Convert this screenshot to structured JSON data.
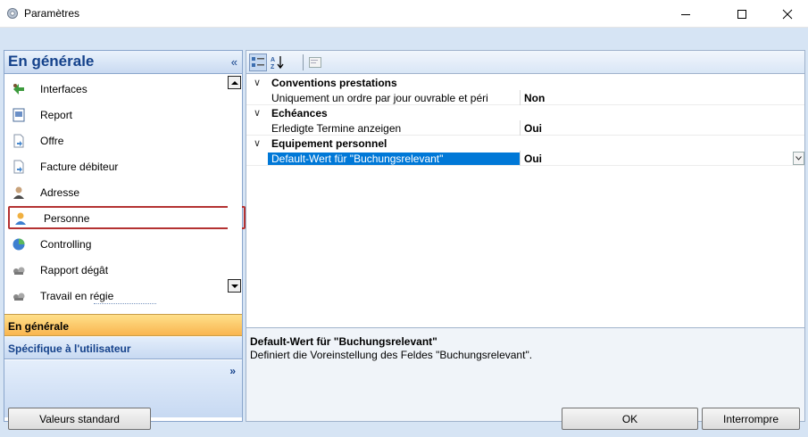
{
  "window": {
    "title": "Paramètres",
    "minimize_glyph": "—",
    "maximize_glyph": "☐",
    "close_glyph": "✕"
  },
  "nav": {
    "header_title": "En générale",
    "collapse_glyph": "«",
    "items": [
      {
        "label": "Interfaces",
        "icon": "interfaces-icon"
      },
      {
        "label": "Report",
        "icon": "report-icon"
      },
      {
        "label": "Offre",
        "icon": "offer-icon"
      },
      {
        "label": "Facture débiteur",
        "icon": "invoice-icon"
      },
      {
        "label": "Adresse",
        "icon": "address-icon"
      },
      {
        "label": "Personne",
        "icon": "person-icon",
        "selected": true
      },
      {
        "label": "Controlling",
        "icon": "controlling-icon"
      },
      {
        "label": "Rapport dégât",
        "icon": "damage-report-icon"
      },
      {
        "label": "Travail en régie",
        "icon": "work-icon"
      }
    ],
    "groups": {
      "general": "En générale",
      "user": "Spécifique à l'utilisateur",
      "more_glyph": "»"
    }
  },
  "grid": {
    "categories": [
      {
        "label": "Conventions prestations",
        "props": [
          {
            "name": "Uniquement un ordre par jour ouvrable et péri",
            "value": "Non"
          }
        ]
      },
      {
        "label": "Echéances",
        "props": [
          {
            "name": "Erledigte Termine anzeigen",
            "value": "Oui"
          }
        ]
      },
      {
        "label": "Equipement personnel",
        "props": [
          {
            "name": "Default-Wert für \"Buchungsrelevant\"",
            "value": "Oui",
            "selected": true
          }
        ]
      }
    ],
    "collapse_glyph": "∨"
  },
  "description": {
    "title": "Default-Wert für \"Buchungsrelevant\"",
    "text": "Definiert die Voreinstellung des Feldes \"Buchungsrelevant\"."
  },
  "buttons": {
    "standard": "Valeurs standard",
    "ok": "OK",
    "cancel": "Interrompre"
  },
  "colors": {
    "frame": "#d6e4f4",
    "header_text": "#15428b",
    "selection": "#0078d7",
    "active_group": "#f9b54f",
    "selected_border": "#b43232"
  }
}
